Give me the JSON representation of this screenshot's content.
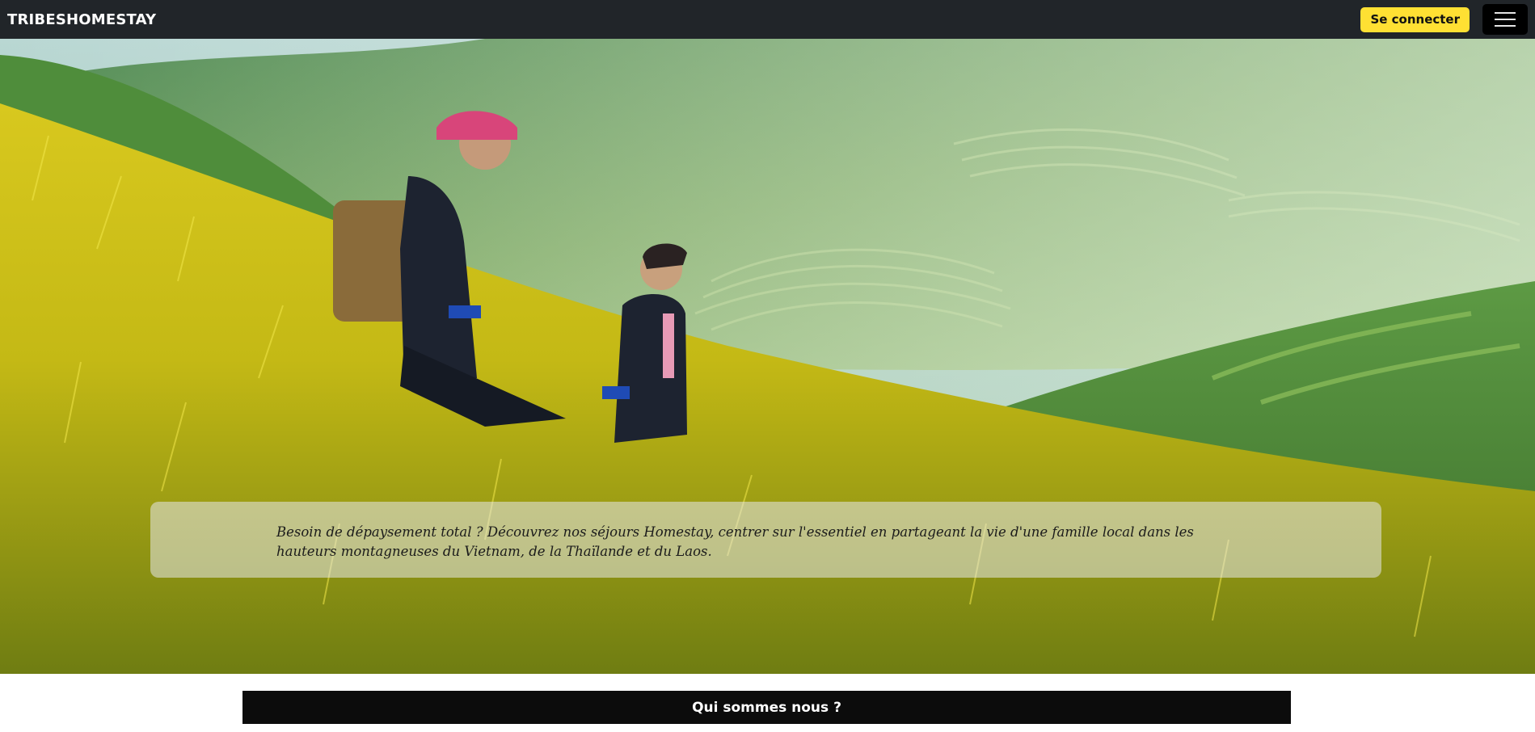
{
  "navbar": {
    "brand": "TRIBESHOMESTAY",
    "login_label": "Se connecter",
    "menu_icon": "hamburger-menu-icon",
    "background_color": "#212529",
    "login_color": "#ffe033"
  },
  "hero": {
    "image": "rice-terraces-mother-and-child",
    "caption": "Besoin de dépaysement total ? Découvrez nos séjours Homestay, centrer sur l'essentiel en partageant la vie d'une famille local dans les hauteurs montagneuses du Vietnam, de la Thaïlande et du Laos."
  },
  "sections": {
    "about_title": "Qui sommes nous ?"
  }
}
